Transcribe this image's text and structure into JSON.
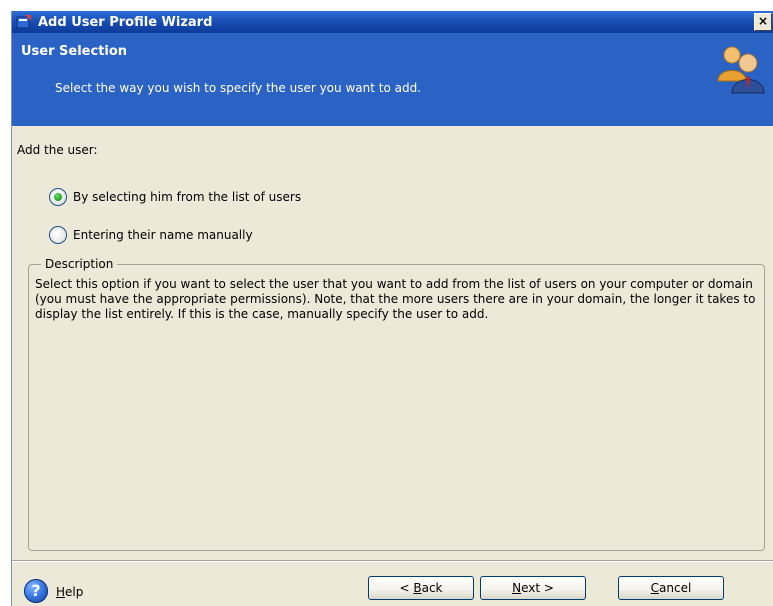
{
  "window": {
    "title": "Add User Profile Wizard",
    "close_glyph": "×"
  },
  "banner": {
    "title": "User Selection",
    "subtitle": "Select the way you wish to specify the user you want to add.",
    "icon": "users-icon"
  },
  "form": {
    "prompt": "Add the user:",
    "options": [
      {
        "label": "By selecting him from the list of users",
        "selected": true
      },
      {
        "label": "Entering their name manually",
        "selected": false
      }
    ]
  },
  "description": {
    "legend": "Description",
    "text": "Select this option if you want to select the user that you want to add from the list of users on your computer or domain (you must have the appropriate permissions). Note, that the more users there are in your domain, the longer it takes to display the list entirely. If this is the case, manually specify the user to add."
  },
  "footer": {
    "help_glyph": "?",
    "help_access": "H",
    "help_rest": "elp",
    "back_prefix": "< ",
    "back_access": "B",
    "back_rest": "ack",
    "next_access": "N",
    "next_rest": "ext >",
    "cancel_access": "C",
    "cancel_rest": "ancel"
  },
  "colors": {
    "banner": "#2a63c4",
    "titlebar": "#1a4fb5",
    "dialog_bg": "#ece9d8",
    "radio_selected": "#2aa82a"
  }
}
